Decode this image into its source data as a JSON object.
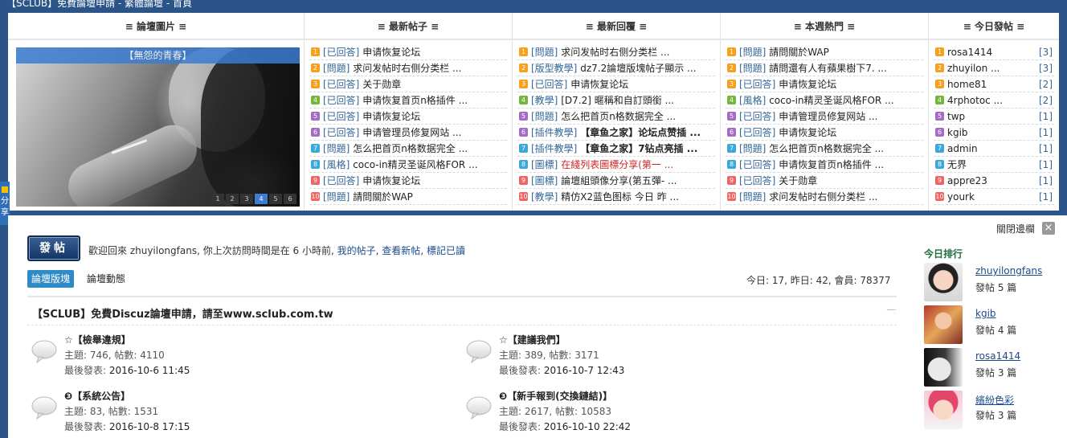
{
  "window": {
    "title": "【SCLUB】免費論壇申請 - 繁體論壇 - 首頁"
  },
  "columns": {
    "images": {
      "header": "≡ 論壇圖片 ≡",
      "caption": "【無怨的青春】",
      "pages": [
        "1",
        "2",
        "3",
        "4",
        "5",
        "6"
      ],
      "active_page": "4"
    },
    "new_posts": {
      "header": "≡ 最新帖子 ≡",
      "items": [
        {
          "n": "1",
          "tag": "[已回答]",
          "title": "申请恢复论坛",
          "style": ""
        },
        {
          "n": "2",
          "tag": "[問題]",
          "title": "求问发帖时右侧分类栏 ...",
          "style": ""
        },
        {
          "n": "3",
          "tag": "[已回答]",
          "title": "关于勋章",
          "style": ""
        },
        {
          "n": "4",
          "tag": "[已回答]",
          "title": "申请恢复首页n格插件 ...",
          "style": ""
        },
        {
          "n": "5",
          "tag": "[已回答]",
          "title": "申请恢复论坛",
          "style": ""
        },
        {
          "n": "6",
          "tag": "[已回答]",
          "title": "申请管理员修复网站 ...",
          "style": ""
        },
        {
          "n": "7",
          "tag": "[問題]",
          "title": "怎么把首页n格数据完全 ...",
          "style": ""
        },
        {
          "n": "8",
          "tag": "[風格]",
          "title": "coco-in精灵圣诞风格FOR ...",
          "style": ""
        },
        {
          "n": "9",
          "tag": "[已回答]",
          "title": "申请恢复论坛",
          "style": ""
        },
        {
          "n": "10",
          "tag": "[問題]",
          "title": "請問關於WAP",
          "style": ""
        }
      ]
    },
    "new_replies": {
      "header": "≡ 最新回覆 ≡",
      "items": [
        {
          "n": "1",
          "tag": "[問題]",
          "title": "求问发帖时右侧分类栏 ...",
          "style": ""
        },
        {
          "n": "2",
          "tag": "[版型教學]",
          "title": "dz7.2論壇版塊帖子顯示 ...",
          "style": ""
        },
        {
          "n": "3",
          "tag": "[已回答]",
          "title": "申请恢复论坛",
          "style": ""
        },
        {
          "n": "4",
          "tag": "[教學]",
          "title": "[D7.2] 暱稱和自訂頭銜 ...",
          "style": ""
        },
        {
          "n": "5",
          "tag": "[問題]",
          "title": "怎么把首页n格数据完全 ...",
          "style": ""
        },
        {
          "n": "6",
          "tag": "[插件教學]",
          "title": "【章鱼之家】论坛点赞插 ...",
          "style": "b"
        },
        {
          "n": "7",
          "tag": "[插件教學]",
          "title": "【章鱼之家】7钻点亮插 ...",
          "style": "b"
        },
        {
          "n": "8",
          "tag": "[圖標]",
          "title": "在綫列表圖標分享(第一 ...",
          "style": "r"
        },
        {
          "n": "9",
          "tag": "[圖標]",
          "title": "論壇組頭像分享(第五彈- ...",
          "style": ""
        },
        {
          "n": "10",
          "tag": "[教學]",
          "title": "精仿X2蓝色图标 今日 昨 ...",
          "style": ""
        }
      ]
    },
    "weekly_hot": {
      "header": "≡ 本週熱門 ≡",
      "items": [
        {
          "n": "1",
          "tag": "[問題]",
          "title": "請問關於WAP",
          "style": ""
        },
        {
          "n": "2",
          "tag": "[問題]",
          "title": "請問還有人有蘋果樹下7. ...",
          "style": ""
        },
        {
          "n": "3",
          "tag": "[已回答]",
          "title": "申请恢复论坛",
          "style": ""
        },
        {
          "n": "4",
          "tag": "[風格]",
          "title": "coco-in精灵圣诞风格FOR ...",
          "style": ""
        },
        {
          "n": "5",
          "tag": "[已回答]",
          "title": "申请管理员修复网站 ...",
          "style": ""
        },
        {
          "n": "6",
          "tag": "[已回答]",
          "title": "申请恢复论坛",
          "style": ""
        },
        {
          "n": "7",
          "tag": "[問題]",
          "title": "怎么把首页n格数据完全 ...",
          "style": ""
        },
        {
          "n": "8",
          "tag": "[已回答]",
          "title": "申请恢复首页n格插件 ...",
          "style": ""
        },
        {
          "n": "9",
          "tag": "[已回答]",
          "title": "关于勋章",
          "style": ""
        },
        {
          "n": "10",
          "tag": "[問題]",
          "title": "求问发帖时右侧分类栏 ...",
          "style": ""
        }
      ]
    },
    "today_posts": {
      "header": "≡ 今日發帖 ≡",
      "items": [
        {
          "n": "1",
          "name": "rosa1414",
          "count": "[3]"
        },
        {
          "n": "2",
          "name": "zhuyilon ...",
          "count": "[3]"
        },
        {
          "n": "3",
          "name": "home81",
          "count": "[2]"
        },
        {
          "n": "4",
          "name": "4rphotoc ...",
          "count": "[2]"
        },
        {
          "n": "5",
          "name": "twp",
          "count": "[1]"
        },
        {
          "n": "6",
          "name": "kgib",
          "count": "[1]"
        },
        {
          "n": "7",
          "name": "admin",
          "count": "[1]"
        },
        {
          "n": "8",
          "name": "无界",
          "count": "[1]"
        },
        {
          "n": "9",
          "name": "appre23",
          "count": "[1]"
        },
        {
          "n": "10",
          "name": "yourk",
          "count": "[1]"
        }
      ]
    }
  },
  "share_tab": {
    "label": "分享"
  },
  "main": {
    "close_sidebar": "關閉邊欄",
    "close_x": "×",
    "post_button": "發帖",
    "welcome": {
      "text": "歡迎回來 zhuyilongfans, 你上次訪問時間是在 6 小時前,",
      "my_posts": "我的帖子",
      "view_new": "查看新帖",
      "mark_read": "標記已讀"
    },
    "tabs": [
      "論壇版塊",
      "論壇動態"
    ],
    "stats": "今日: 17, 昨日: 42, 會員: 78377",
    "category_title": "【SCLUB】免費Discuz論壇申請，請至www.sclub.com.tw",
    "forums": [
      {
        "name": "☆【檢舉違規】",
        "stat": "主題: 746, 帖數: 4110",
        "last_label": "最後發表:",
        "last": "2016-10-6 11:45"
      },
      {
        "name": "☆【建議我們】",
        "stat": "主題: 389, 帖數: 3171",
        "last_label": "最後發表:",
        "last": "2016-10-7 12:43"
      },
      {
        "name": "❸【系統公告】",
        "stat": "主題: 83, 帖數: 1531",
        "last_label": "最後發表:",
        "last": "2016-10-8 17:15"
      },
      {
        "name": "❸【新手報到(交換鏈結)】",
        "stat": "主題: 2617, 帖數: 10583",
        "last_label": "最後發表:",
        "last": "2016-10-10 22:42"
      }
    ],
    "ranking": {
      "title": "今日排行",
      "users": [
        {
          "name": "zhuyilongfans",
          "count": "發帖 5 篇"
        },
        {
          "name": "kgib",
          "count": "發帖 4 篇"
        },
        {
          "name": "rosa1414",
          "count": "發帖 3 篇"
        },
        {
          "name": "繽紛色彩",
          "count": "發帖 3 篇"
        }
      ]
    }
  }
}
